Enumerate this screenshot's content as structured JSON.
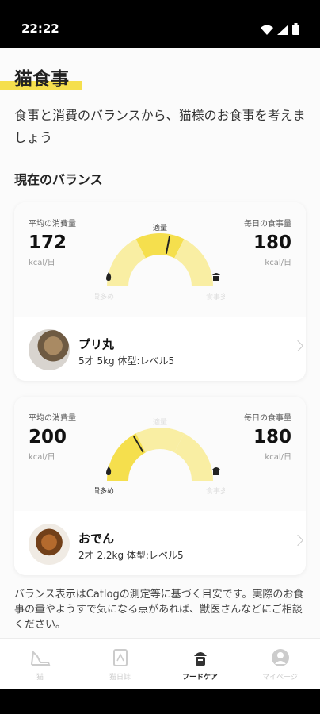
{
  "status": {
    "time": "22:22"
  },
  "header": {
    "title": "猫食事",
    "subtitle": "食事と消費のバランスから、猫様のお食事を考えましょう"
  },
  "balance_section": {
    "title": "現在のバランス"
  },
  "cards": [
    {
      "consumption_label": "平均の消費量",
      "consumption_value": "172",
      "consumption_unit": "kcal/日",
      "meal_label": "毎日の食事量",
      "meal_value": "180",
      "meal_unit": "kcal/日",
      "gauge": {
        "top_label": "適量",
        "left_label": "消費多め",
        "right_label": "食事多め",
        "needle_position": 0.56,
        "highlighted": "top"
      },
      "cat": {
        "name": "プリ丸",
        "info": "5才 5kg 体型:レベル5"
      }
    },
    {
      "consumption_label": "平均の消費量",
      "consumption_value": "200",
      "consumption_unit": "kcal/日",
      "meal_label": "毎日の食事量",
      "meal_value": "180",
      "meal_unit": "kcal/日",
      "gauge": {
        "top_label": "適量",
        "left_label": "消費多め",
        "right_label": "食事多め",
        "needle_position": 0.33,
        "highlighted": "left"
      },
      "cat": {
        "name": "おでん",
        "info": "2才 2.2kg 体型:レベル5"
      }
    }
  ],
  "note": "バランス表示はCatlogの測定等に基づく目安です。実際のお食事の量やようすで気になる点があれば、獣医さんなどにご相談ください。",
  "nav": [
    {
      "label": "猫",
      "icon": "cat-icon",
      "active": false
    },
    {
      "label": "猫日誌",
      "icon": "journal-icon",
      "active": false
    },
    {
      "label": "フードケア",
      "icon": "food-bowl-icon",
      "active": true
    },
    {
      "label": "マイページ",
      "icon": "user-icon",
      "active": false
    }
  ],
  "colors": {
    "accent": "#f5df4d",
    "accent_light": "#f9eea3",
    "text": "#222222"
  }
}
